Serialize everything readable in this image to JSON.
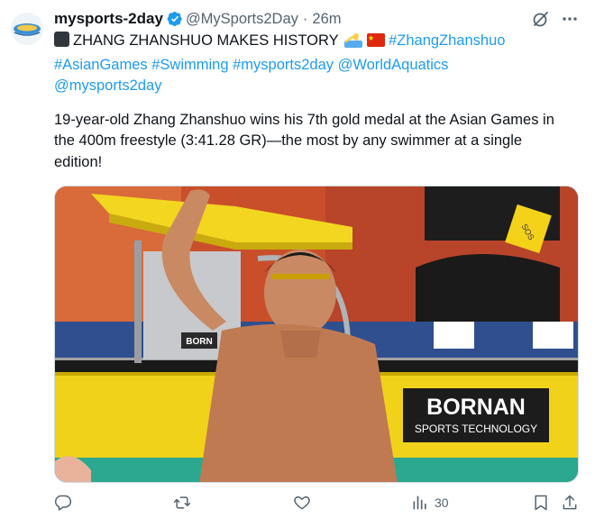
{
  "tweet": {
    "display_name": "mysports-2day",
    "handle": "@MySports2Day",
    "separator": "·",
    "time": "26m",
    "headline": {
      "text": "ZHANG ZHANSHUO MAKES HISTORY",
      "hashtag": "#ZhangZhanshuo"
    },
    "tags_line1": {
      "asian_games": "#AsianGames",
      "swimming": "#Swimming",
      "mysports": "#mysports2day",
      "world_aquatics": "@WorldAquatics"
    },
    "tags_line2": {
      "mysports_mention": "@mysports2day"
    },
    "body": [
      "19-year-old Zhang Zhanshuo wins his 7th gold medal at the Asian Games in",
      "the 400m freestyle (3:41.28 GR)—the most by any swimmer at a single",
      "edition!"
    ],
    "media": {
      "banner_text": "BORNAN",
      "banner_subtext": "SPORTS TECHNOLOGY",
      "block_label": "BORN",
      "badge_text": "SOS"
    },
    "views": "30"
  },
  "icons": {
    "verified": "verified-badge-icon",
    "grok": "grok-icon",
    "more": "more-icon",
    "reply": "reply-icon",
    "retweet": "retweet-icon",
    "like": "like-icon",
    "views": "views-icon",
    "bookmark": "bookmark-icon",
    "share": "share-icon"
  },
  "colors": {
    "link": "#1d9bf0",
    "secondary_text": "#536471",
    "verified": "#1d9bf0"
  }
}
